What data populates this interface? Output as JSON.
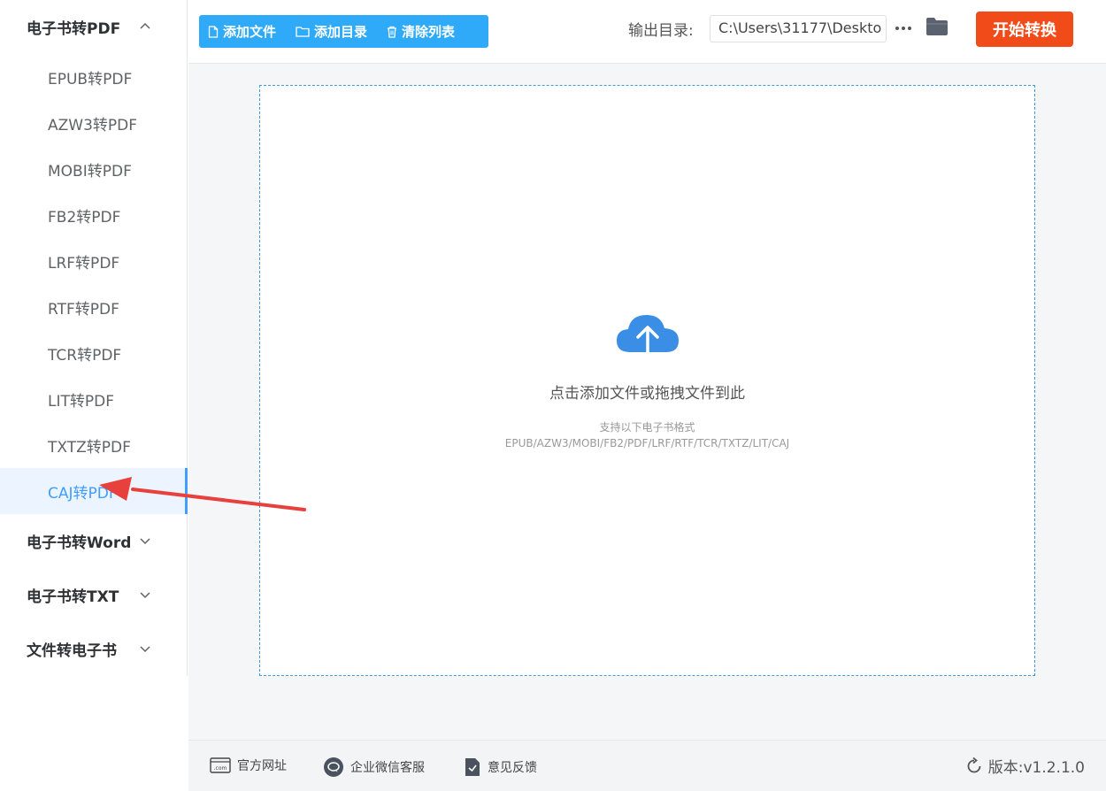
{
  "sidebar": {
    "group1": {
      "label": "电子书转PDF"
    },
    "items": [
      {
        "label": "EPUB转PDF"
      },
      {
        "label": "AZW3转PDF"
      },
      {
        "label": "MOBI转PDF"
      },
      {
        "label": "FB2转PDF"
      },
      {
        "label": "LRF转PDF"
      },
      {
        "label": "RTF转PDF"
      },
      {
        "label": "TCR转PDF"
      },
      {
        "label": "LIT转PDF"
      },
      {
        "label": "TXTZ转PDF"
      },
      {
        "label": "CAJ转PDF"
      }
    ],
    "group2": {
      "label": "电子书转Word"
    },
    "group3": {
      "label": "电子书转TXT"
    },
    "group4": {
      "label": "文件转电子书"
    }
  },
  "toolbar": {
    "add_file": "添加文件",
    "add_dir": "添加目录",
    "clear_list": "清除列表",
    "output_label": "输出目录:",
    "output_value": "C:\\Users\\31177\\Deskto",
    "start": "开始转换"
  },
  "dropzone": {
    "title": "点击添加文件或拖拽文件到此",
    "subtitle": "支持以下电子书格式",
    "formats": "EPUB/AZW3/MOBI/FB2/PDF/LRF/RTF/TCR/TXTZ/LIT/CAJ"
  },
  "footer": {
    "website": "官方网址",
    "wechat": "企业微信客服",
    "feedback": "意见反馈",
    "version": "版本:v1.2.1.0"
  },
  "colors": {
    "accent": "#409eff",
    "toolbar_blue": "#2eaaf9",
    "start_orange": "#f24b1a",
    "arrow_red": "#e8413d"
  }
}
